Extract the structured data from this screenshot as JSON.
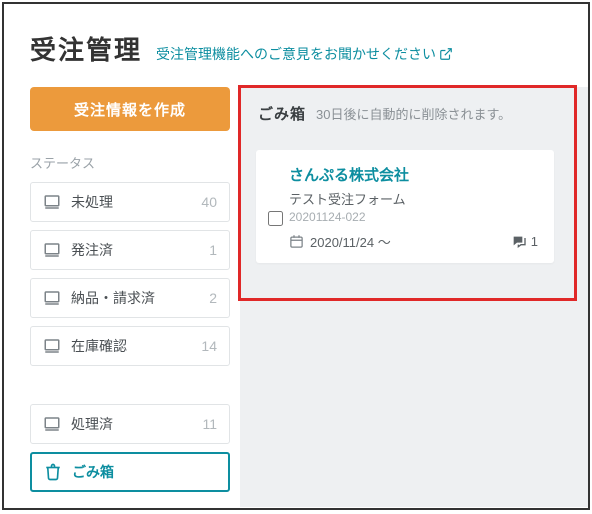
{
  "header": {
    "title": "受注管理",
    "feedback_link": "受注管理機能へのご意見をお聞かせください"
  },
  "sidebar": {
    "create_button": "受注情報を作成",
    "status_label": "ステータス",
    "items": [
      {
        "label": "未処理",
        "count": "40"
      },
      {
        "label": "発注済",
        "count": "1"
      },
      {
        "label": "納品・請求済",
        "count": "2"
      },
      {
        "label": "在庫確認",
        "count": "14"
      }
    ],
    "processed": {
      "label": "処理済",
      "count": "11"
    },
    "trash": {
      "label": "ごみ箱"
    }
  },
  "main": {
    "trash": {
      "title": "ごみ箱",
      "note": "30日後に自動的に削除されます。"
    },
    "orders": [
      {
        "company": "さんぷる株式会社",
        "form_name": "テスト受注フォーム",
        "order_id": "20201124-022",
        "date": "2020/11/24 〜",
        "comment_count": "1"
      }
    ]
  }
}
